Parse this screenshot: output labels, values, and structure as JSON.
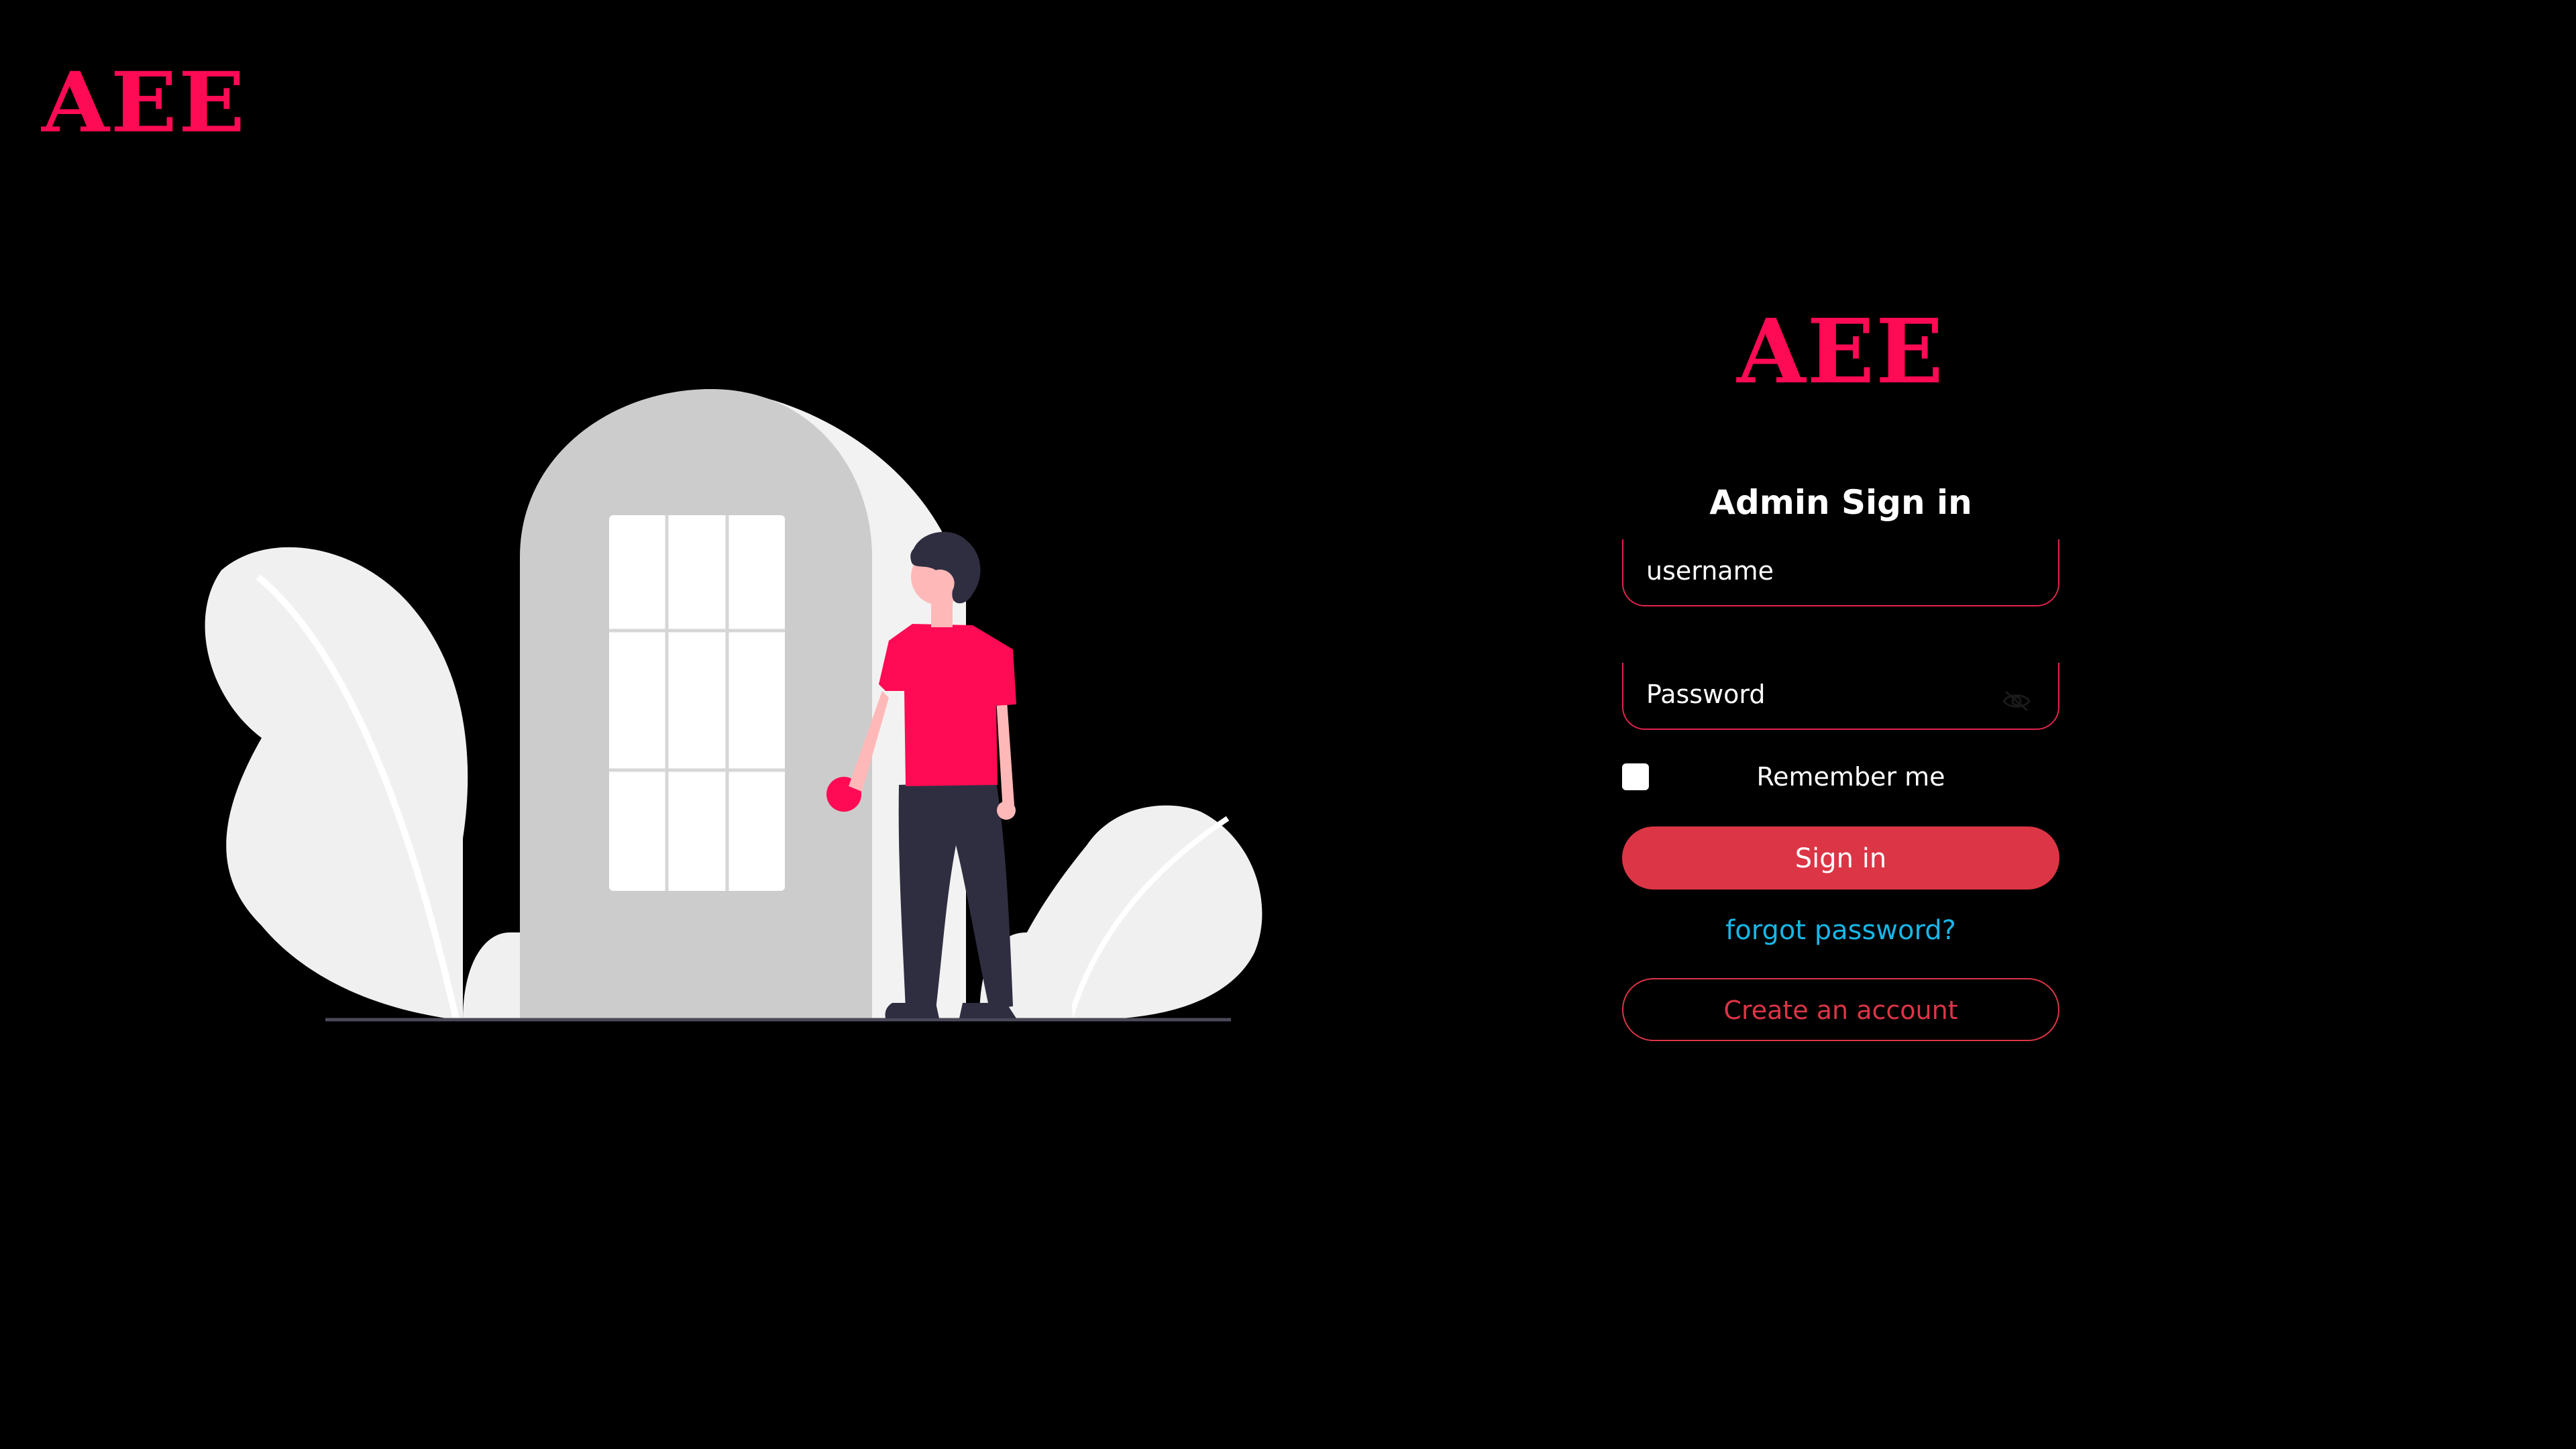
{
  "brand": {
    "logo_text": "AEE",
    "color": "#ff0a54"
  },
  "login": {
    "title": "Admin Sign in",
    "username_placeholder": "username",
    "password_placeholder": "Password",
    "password_toggle_icon": "eye-slash-icon",
    "remember_label": "Remember me",
    "remember_checked": false,
    "signin_label": "Sign in",
    "forgot_label": "forgot password?",
    "create_label": "Create an account"
  },
  "colors": {
    "background": "#000000",
    "accent": "#dc3545",
    "link": "#17b6e8"
  },
  "illustration": {
    "name": "person-at-door-illustration"
  }
}
